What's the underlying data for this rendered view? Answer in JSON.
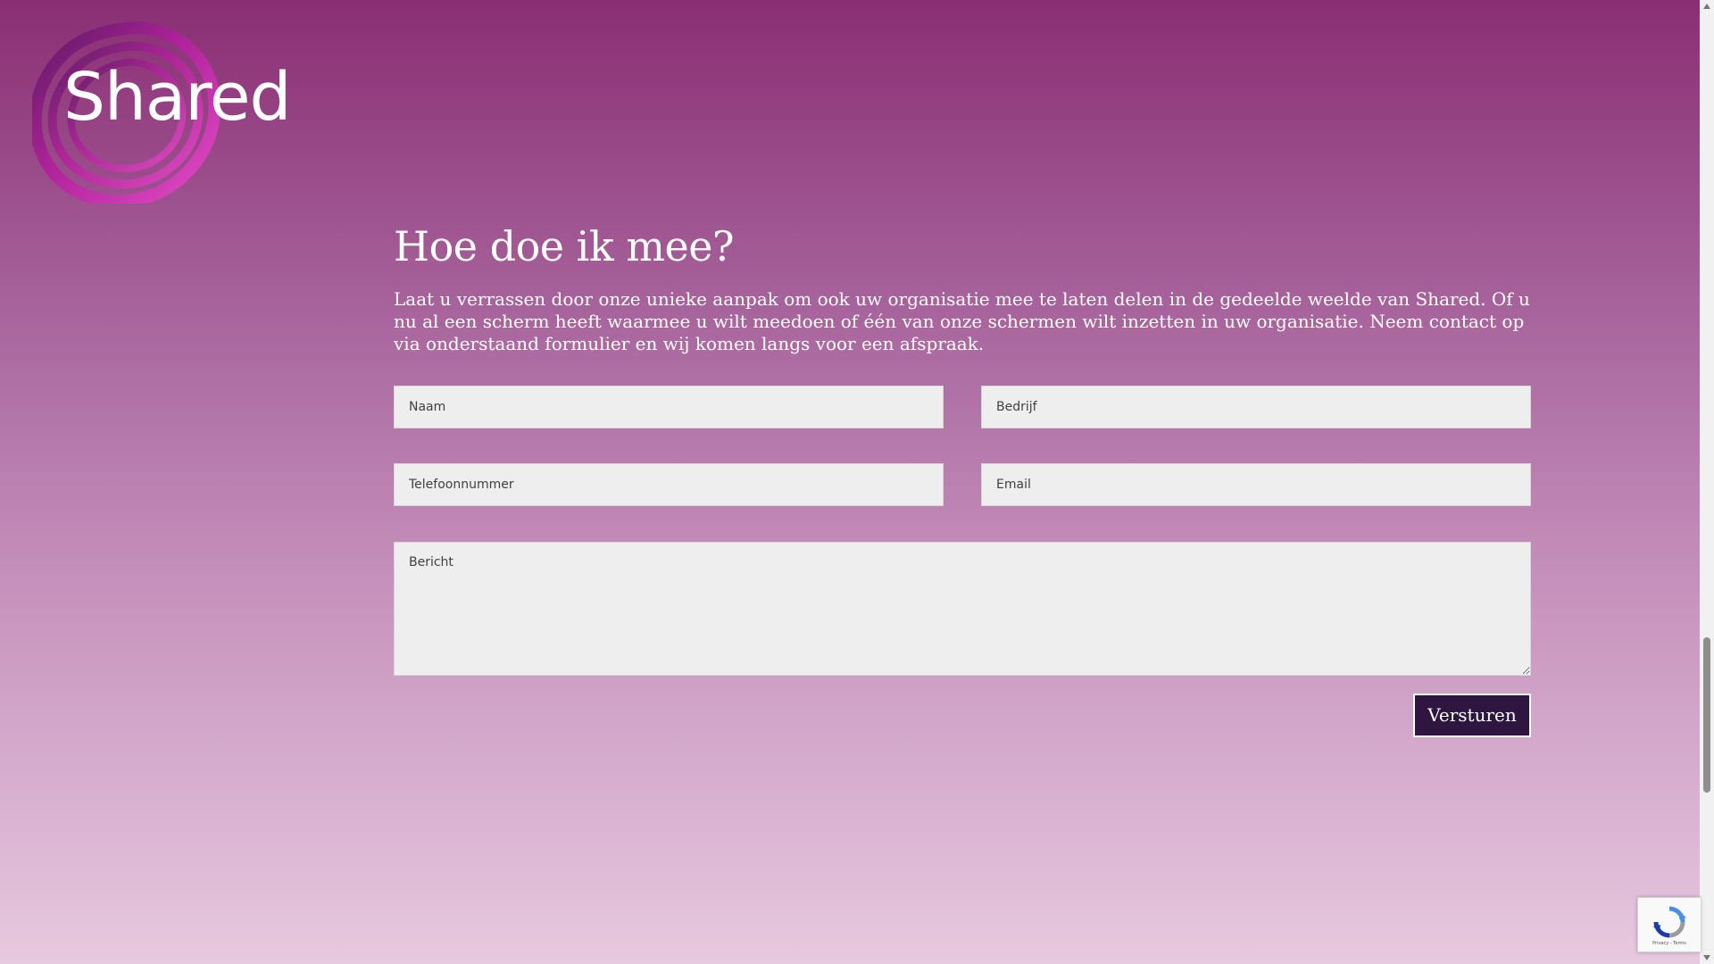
{
  "brand": {
    "logo_text": "Shared",
    "colors": {
      "background_top": "#8a2e74",
      "background_bottom": "#e7c9df",
      "button": "#2e1640",
      "field": "#eeeeee"
    }
  },
  "main": {
    "title": "Hoe doe ik mee?",
    "intro": "Laat u verrassen door onze unieke aanpak om ook uw organisatie mee te laten delen in de gedeelde weelde van Shared. Of u nu al een scherm heeft waarmee u wilt meedoen of één van onze schermen wilt inzetten in uw organisatie. Neem contact op via onderstaand formulier en wij komen langs voor een afspraak."
  },
  "form": {
    "name_placeholder": "Naam",
    "company_placeholder": "Bedrijf",
    "phone_placeholder": "Telefoonnummer",
    "email_placeholder": "Email",
    "message_placeholder": "Bericht",
    "submit_label": "Versturen"
  },
  "recaptcha": {
    "links_text": "Privacy - Terms",
    "icon": "recaptcha-icon"
  },
  "scrollbar": {
    "position_fraction": 0.72
  }
}
